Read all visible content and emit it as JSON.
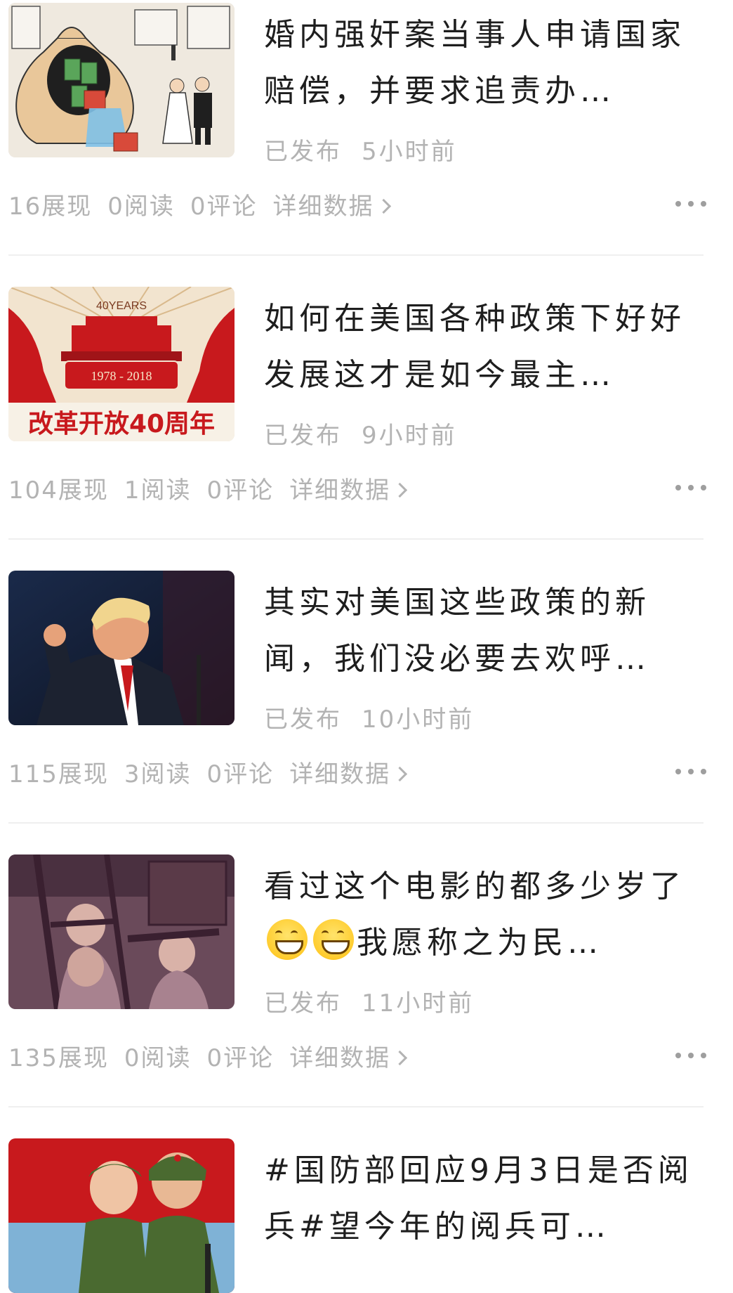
{
  "posts": [
    {
      "title": "婚内强奸案当事人申请国家赔偿，并要求追责办…",
      "status": "已发布",
      "time": "5小时前",
      "impressions": "16展现",
      "reads": "0阅读",
      "comments": "0评论",
      "detail": "详细数据"
    },
    {
      "title": "如何在美国各种政策下好好发展这才是如今最主…",
      "status": "已发布",
      "time": "9小时前",
      "impressions": "104展现",
      "reads": "1阅读",
      "comments": "0评论",
      "detail": "详细数据",
      "thumb_text": {
        "years": "40YEARS",
        "span": "1978 - 2018",
        "banner": "改革开放40周年"
      }
    },
    {
      "title": "其实对美国这些政策的新闻，我们没必要去欢呼…",
      "status": "已发布",
      "time": "10小时前",
      "impressions": "115展现",
      "reads": "3阅读",
      "comments": "0评论",
      "detail": "详细数据"
    },
    {
      "title_part1": "看过这个电影的都多少岁了",
      "title_part2": "我愿称之为民…",
      "status": "已发布",
      "time": "11小时前",
      "impressions": "135展现",
      "reads": "0阅读",
      "comments": "0评论",
      "detail": "详细数据"
    },
    {
      "title": "#国防部回应9月3日是否阅兵#望今年的阅兵可…"
    }
  ],
  "colors": {
    "meta_text": "#b3b3b3",
    "title_text": "#1e1e1e",
    "divider": "#efefef"
  },
  "icons": {
    "chevron": "chevron-right-icon",
    "more": "more-dots-icon",
    "emoji": "grinning-face-emoji"
  }
}
